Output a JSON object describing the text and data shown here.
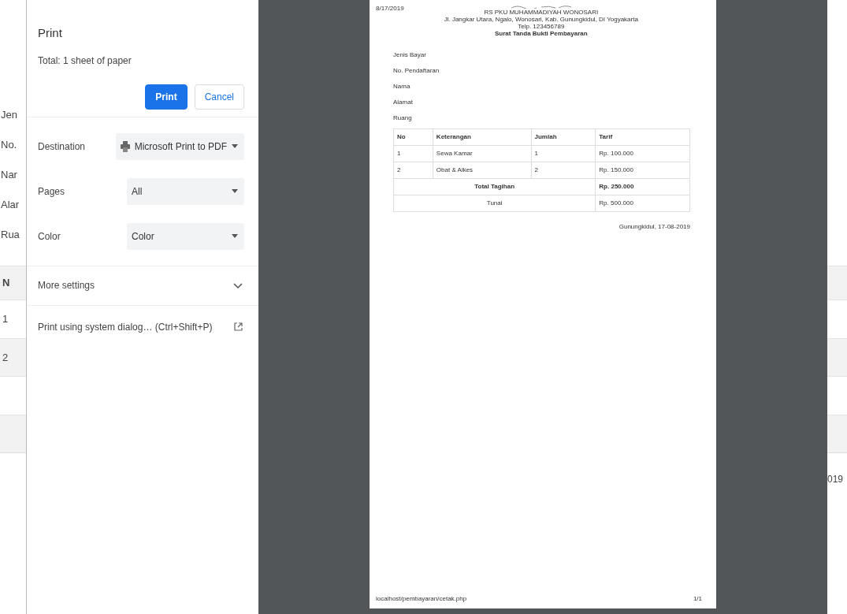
{
  "background_page": {
    "field_labels": [
      "Jen",
      "No.",
      "Nar",
      "Alar",
      "Rua"
    ],
    "table_left_cells": [
      {
        "text": "N",
        "kind": "header"
      },
      {
        "text": "1",
        "kind": "cell"
      },
      {
        "text": "2",
        "kind": "cell"
      }
    ],
    "date_fragment": "019"
  },
  "print_panel": {
    "title": "Print",
    "summary": "Total: 1 sheet of paper",
    "buttons": [
      {
        "label": "Print",
        "kind": "primary"
      },
      {
        "label": "Cancel",
        "kind": "secondary"
      }
    ],
    "settings": [
      {
        "label": "Destination",
        "value": "Microsoft Print to PDF",
        "kind": "destination"
      },
      {
        "label": "Pages",
        "value": "All",
        "kind": "select"
      },
      {
        "label": "Color",
        "value": "Color",
        "kind": "select"
      }
    ],
    "more_settings": {
      "label": "More settings",
      "expanded": false
    },
    "system_dialog_link": "Print using system dialog… (Ctrl+Shift+P)"
  },
  "preview": {
    "header_left": "8/17/2019",
    "hospital_name": "RS PKU MUHAMMADIYAH WONOSARI",
    "address": "Jl. Jangkar Utara, Ngalo, Wonosari, Kab. Gunungkidul, DI Yogyakarta",
    "phone": "Telp. 123456789",
    "document_title": "Surat Tanda Bukti Pembayaran",
    "fields": [
      "Jenis Bayar",
      "No. Pendaftaran",
      "Nama",
      "Alamat",
      "Ruang"
    ],
    "table": {
      "columns": [
        "No",
        "Keterangan",
        "Jumlah",
        "Tarif"
      ],
      "rows": [
        [
          "1",
          "Sewa Kamar",
          "1",
          "Rp. 100.000"
        ],
        [
          "2",
          "Obat & Alkes",
          "2",
          "Rp. 150.000"
        ]
      ],
      "summary_rows": [
        {
          "label": "Total Tagihan",
          "value": "Rp. 250.000",
          "bold": true
        },
        {
          "label": "Tunai",
          "value": "Rp. 500.000",
          "bold": false
        }
      ]
    },
    "place_date": "Gunungkidul, 17-08-2019",
    "footer_url": "localhost/pembayaran/cetak.php",
    "page_number": "1/1"
  }
}
